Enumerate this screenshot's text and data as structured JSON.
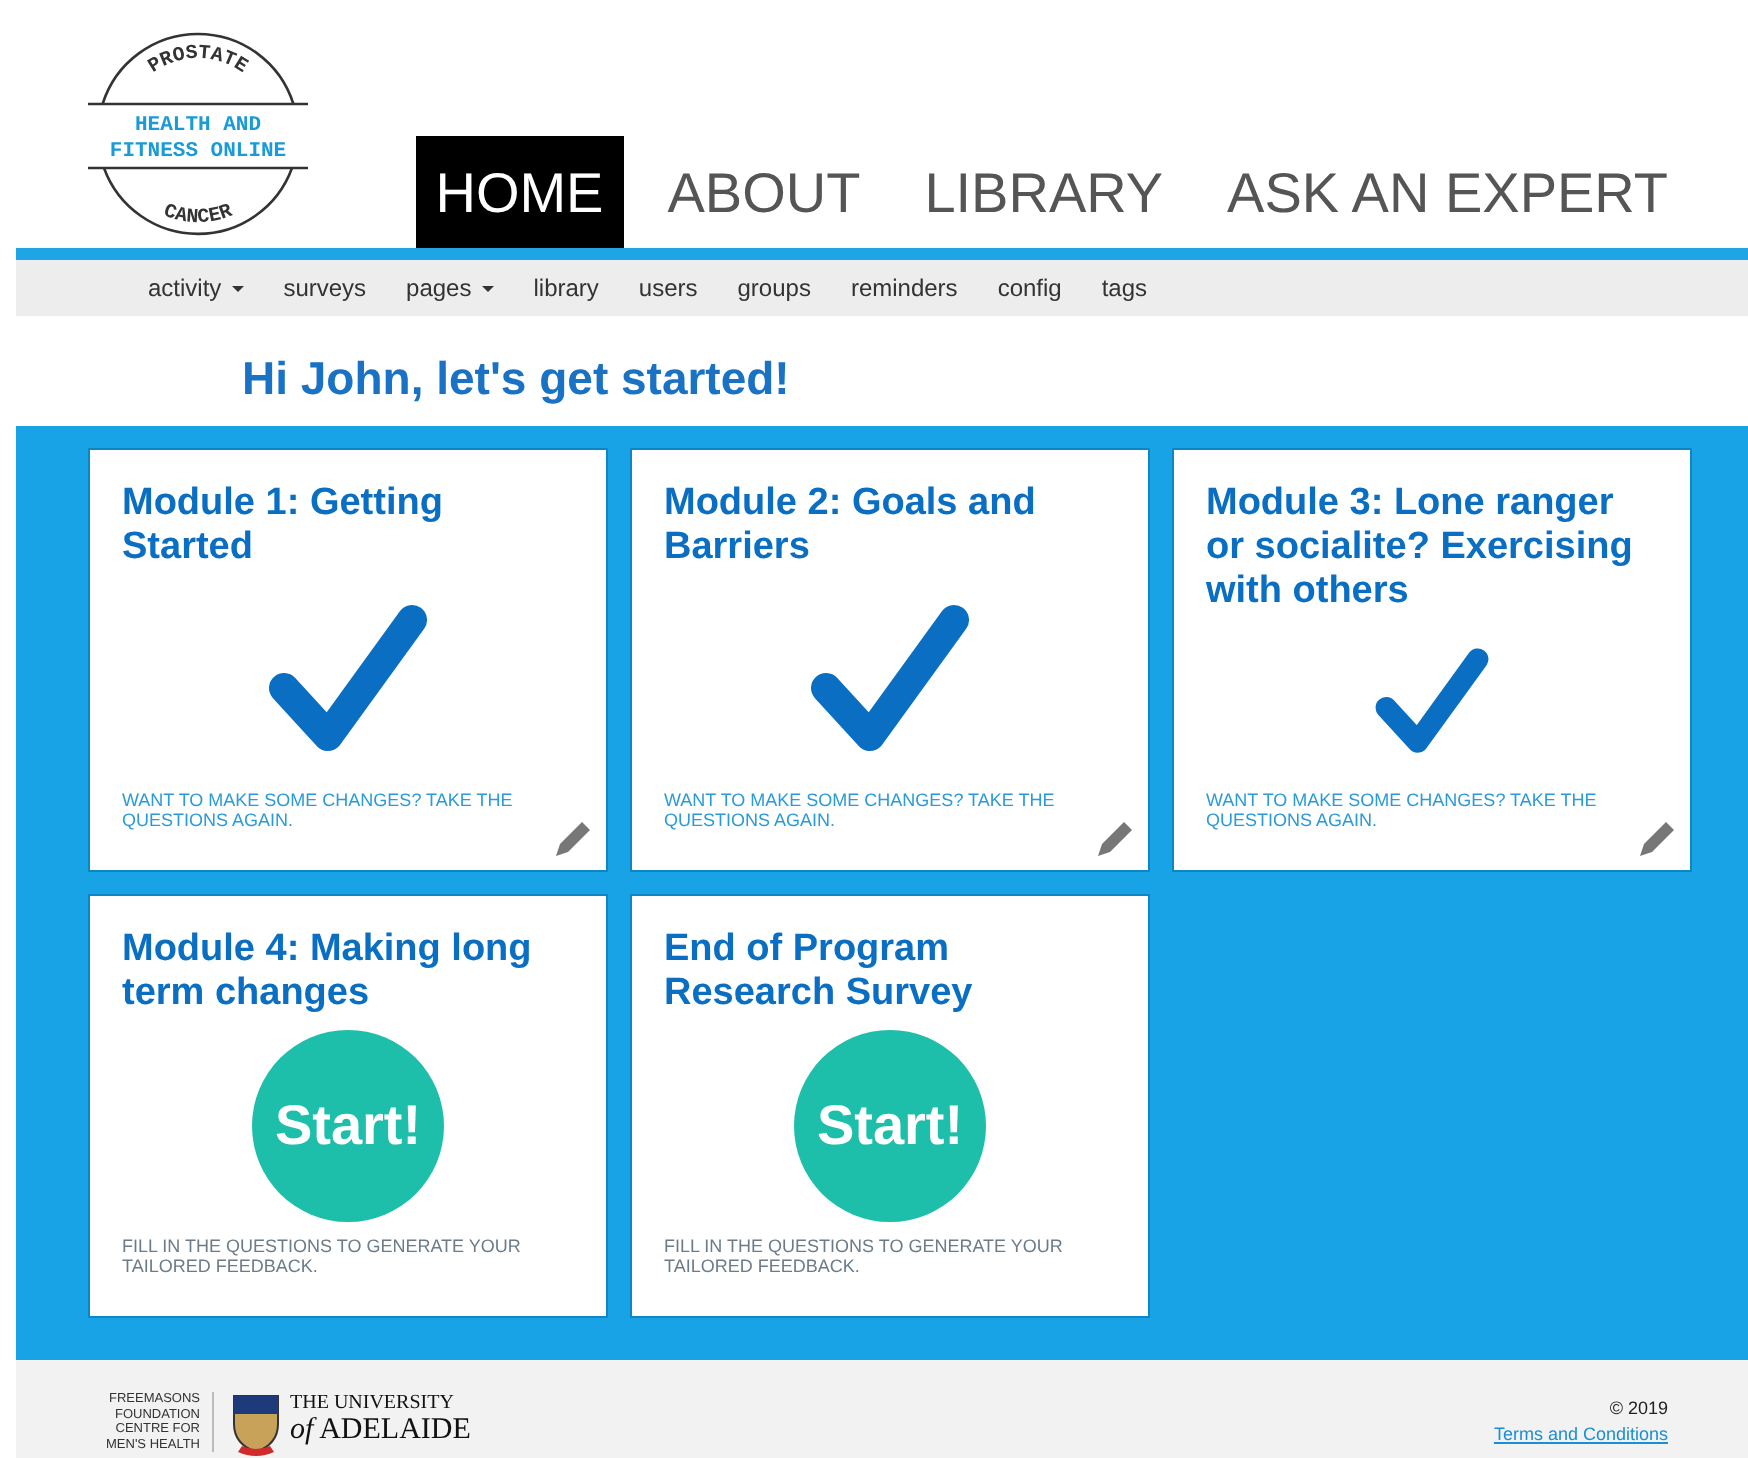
{
  "logo": {
    "top": "PROSTATE",
    "middle": [
      "HEALTH AND",
      "FITNESS ONLINE"
    ],
    "bottom": "CANCER"
  },
  "nav": [
    {
      "label": "HOME",
      "selected": true
    },
    {
      "label": "ABOUT",
      "selected": false
    },
    {
      "label": "LIBRARY",
      "selected": false
    },
    {
      "label": "ASK AN EXPERT",
      "selected": false
    }
  ],
  "admin_menu": [
    {
      "label": "activity",
      "dropdown": true
    },
    {
      "label": "surveys",
      "dropdown": false
    },
    {
      "label": "pages",
      "dropdown": true
    },
    {
      "label": "library",
      "dropdown": false
    },
    {
      "label": "users",
      "dropdown": false
    },
    {
      "label": "groups",
      "dropdown": false
    },
    {
      "label": "reminders",
      "dropdown": false
    },
    {
      "label": "config",
      "dropdown": false
    },
    {
      "label": "tags",
      "dropdown": false
    }
  ],
  "greeting": "Hi John, let's get started!",
  "modules": [
    {
      "title": "Module 1: Getting Started",
      "kind": "done",
      "note": "WANT TO MAKE SOME CHANGES? TAKE THE QUESTIONS AGAIN."
    },
    {
      "title": "Module 2: Goals and Barriers",
      "kind": "done",
      "note": "WANT TO MAKE SOME CHANGES? TAKE THE QUESTIONS AGAIN."
    },
    {
      "title": "Module 3: Lone ranger or socialite? Exercising with others",
      "kind": "done",
      "note": "WANT TO MAKE SOME CHANGES? TAKE THE QUESTIONS AGAIN."
    },
    {
      "title": "Module 4: Making long term changes",
      "kind": "start",
      "button": "Start!",
      "note": "FILL IN THE QUESTIONS TO GENERATE YOUR TAILORED FEEDBACK."
    },
    {
      "title": "End of Program Research Survey",
      "kind": "start",
      "button": "Start!",
      "note": "FILL IN THE QUESTIONS TO GENERATE YOUR TAILORED FEEDBACK."
    }
  ],
  "footer": {
    "partner": [
      "FREEMASONS",
      "FOUNDATION",
      "CENTRE FOR",
      "MEN'S HEALTH"
    ],
    "university": [
      "THE UNIVERSITY",
      "*of* ADELAIDE"
    ],
    "copyright": "© 2019",
    "terms_link": "Terms and Conditions"
  }
}
